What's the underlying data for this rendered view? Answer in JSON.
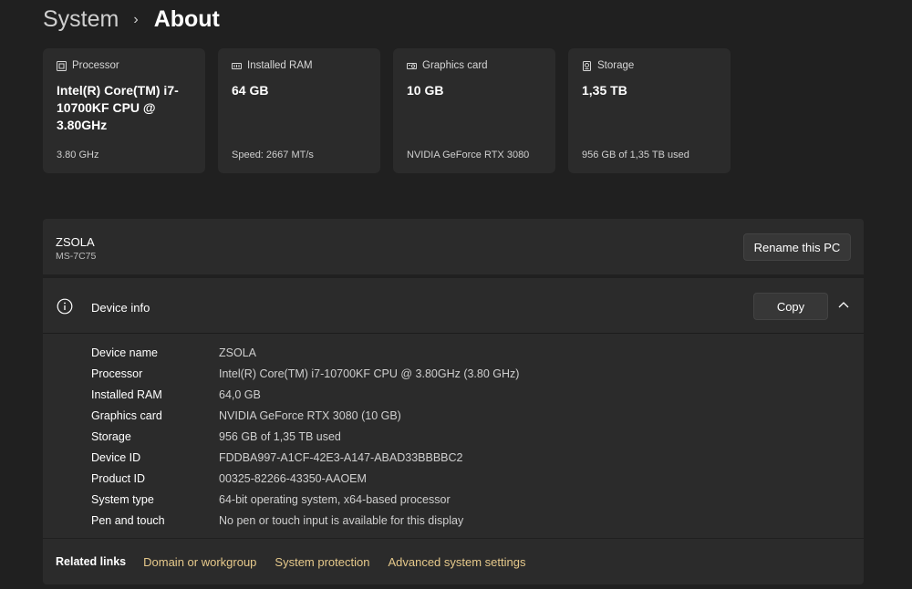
{
  "header": {
    "parent": "System",
    "separator": "›",
    "current": "About"
  },
  "cards": [
    {
      "icon": "processor-icon",
      "label": "Processor",
      "value": "Intel(R) Core(TM) i7-10700KF CPU @ 3.80GHz",
      "sub": "3.80 GHz"
    },
    {
      "icon": "ram-icon",
      "label": "Installed RAM",
      "value": "64 GB",
      "sub": "Speed: 2667 MT/s"
    },
    {
      "icon": "graphics-card-icon",
      "label": "Graphics card",
      "value": "10 GB",
      "sub": "NVIDIA GeForce RTX 3080"
    },
    {
      "icon": "storage-icon",
      "label": "Storage",
      "value": "1,35 TB",
      "sub": "956 GB of 1,35 TB used"
    }
  ],
  "pc": {
    "name": "ZSOLA",
    "model": "MS-7C75",
    "rename_label": "Rename this PC"
  },
  "device_info": {
    "title": "Device info",
    "copy_label": "Copy",
    "rows": [
      {
        "key": "Device name",
        "value": "ZSOLA"
      },
      {
        "key": "Processor",
        "value": "Intel(R) Core(TM) i7-10700KF CPU @ 3.80GHz (3.80 GHz)"
      },
      {
        "key": "Installed RAM",
        "value": "64,0 GB"
      },
      {
        "key": "Graphics card",
        "value": "NVIDIA GeForce RTX 3080 (10 GB)"
      },
      {
        "key": "Storage",
        "value": "956 GB of 1,35 TB used"
      },
      {
        "key": "Device ID",
        "value": "FDDBA997-A1CF-42E3-A147-ABAD33BBBBC2"
      },
      {
        "key": "Product ID",
        "value": "00325-82266-43350-AAOEM"
      },
      {
        "key": "System type",
        "value": "64-bit operating system, x64-based processor"
      },
      {
        "key": "Pen and touch",
        "value": "No pen or touch input is available for this display"
      }
    ]
  },
  "related_links": {
    "title": "Related links",
    "links": [
      "Domain or workgroup",
      "System protection",
      "Advanced system settings"
    ]
  },
  "colors": {
    "background": "#202020",
    "panel": "#2b2b2b",
    "link": "#e6c98b"
  }
}
